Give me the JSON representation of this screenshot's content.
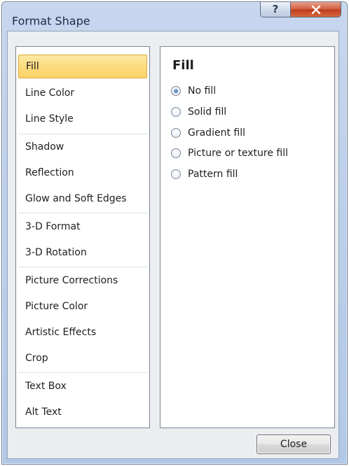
{
  "window": {
    "title": "Format Shape",
    "help_label": "?",
    "close_label": "X"
  },
  "nav": {
    "items": [
      {
        "label": "Fill"
      },
      {
        "label": "Line Color"
      },
      {
        "label": "Line Style"
      },
      {
        "label": "Shadow"
      },
      {
        "label": "Reflection"
      },
      {
        "label": "Glow and Soft Edges"
      },
      {
        "label": "3-D Format"
      },
      {
        "label": "3-D Rotation"
      },
      {
        "label": "Picture Corrections"
      },
      {
        "label": "Picture Color"
      },
      {
        "label": "Artistic Effects"
      },
      {
        "label": "Crop"
      },
      {
        "label": "Text Box"
      },
      {
        "label": "Alt Text"
      }
    ],
    "selected": "Fill"
  },
  "panel": {
    "heading": "Fill",
    "options": [
      {
        "label": "No fill",
        "checked": true
      },
      {
        "label": "Solid fill",
        "checked": false
      },
      {
        "label": "Gradient fill",
        "checked": false
      },
      {
        "label": "Picture or texture fill",
        "checked": false
      },
      {
        "label": "Pattern fill",
        "checked": false
      }
    ]
  },
  "footer": {
    "close_button": "Close"
  },
  "colors": {
    "selection_fill": "#fcd979",
    "selection_border": "#d8a93b",
    "close_x_red": "#c8472a",
    "dialog_blue": "#bdd0eb"
  },
  "icons": {
    "help": "help-icon",
    "close": "close-icon",
    "radio_checked": "radio-checked-icon",
    "radio_unchecked": "radio-unchecked-icon"
  }
}
